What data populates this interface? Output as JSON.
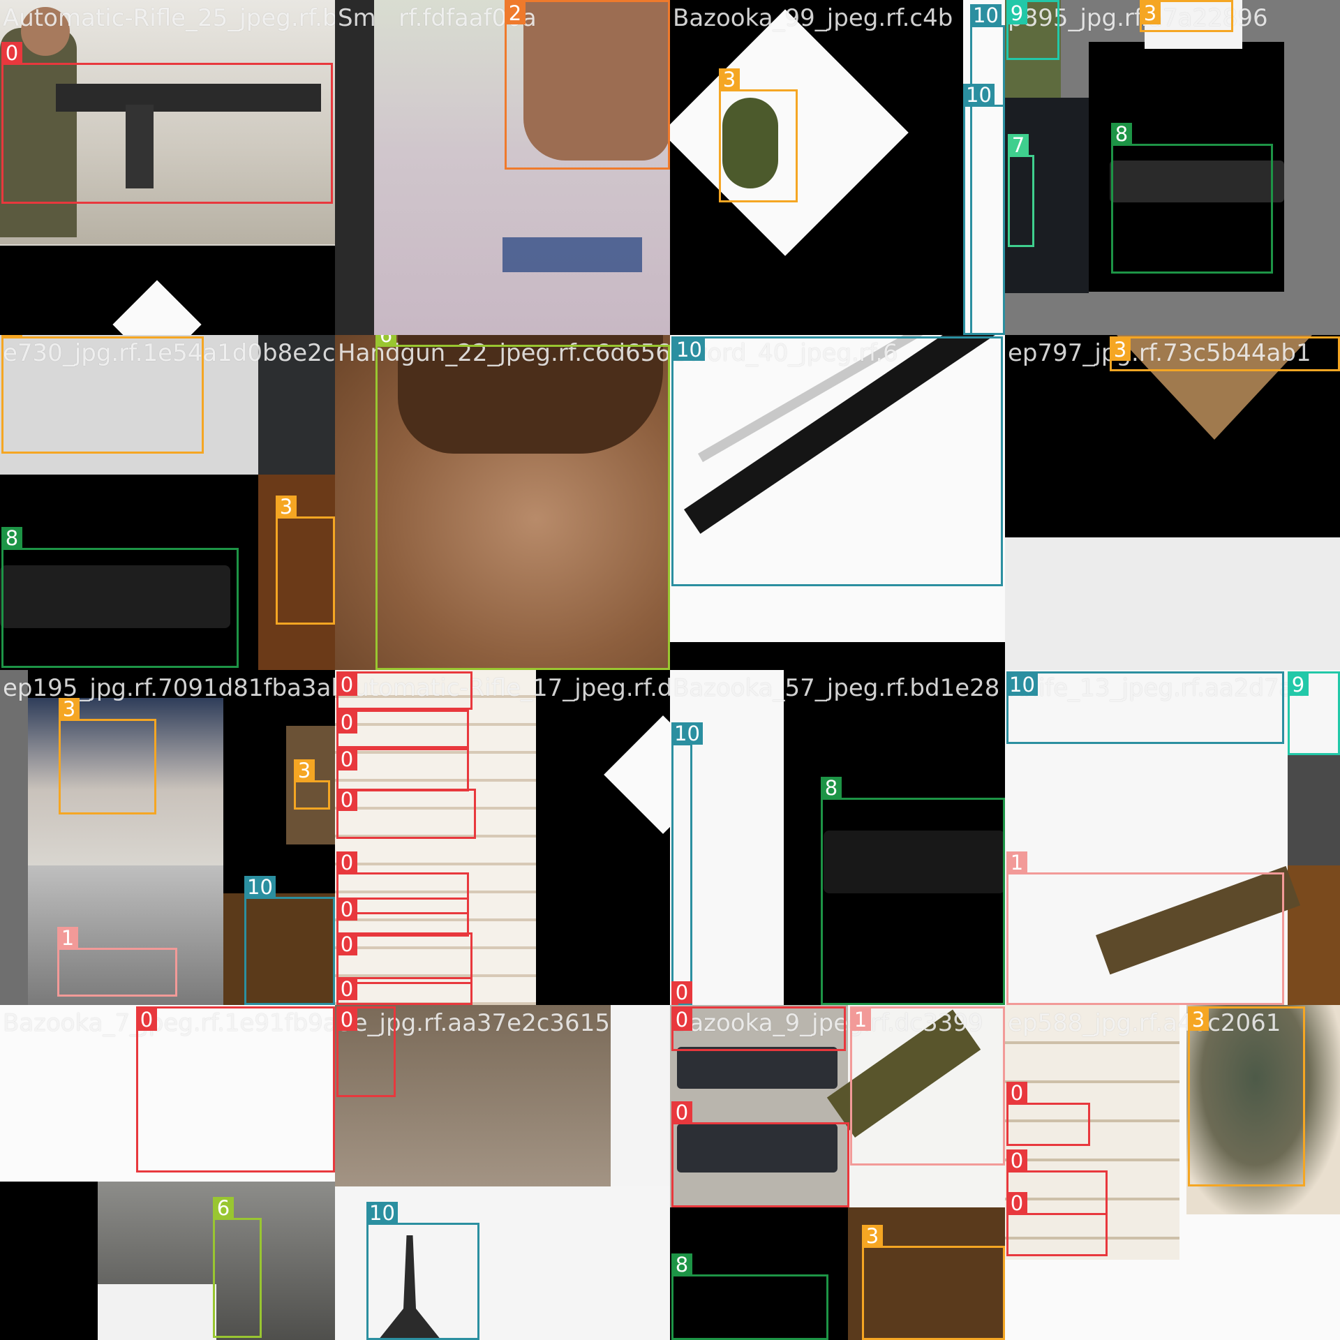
{
  "palette": {
    "0": "#e8383d",
    "1": "#f29a98",
    "2": "#ef7a2c",
    "3": "#f5a623",
    "6": "#99c631",
    "7": "#3fcf8e",
    "8": "#1d9446",
    "9": "#22c8a8",
    "10": "#2b8fa0"
  },
  "tiles": [
    {
      "name": "Automatic-Rifle_25_jpeg.rf.b",
      "class_ids": [
        "0"
      ]
    },
    {
      "name": "Sm   rf.fdfaaf00a",
      "class_ids": [
        "2"
      ]
    },
    {
      "name": "Bazooka_99_jpeg.rf.c4b",
      "class_ids": [
        "3",
        "10",
        "10"
      ]
    },
    {
      "name": "p895_jpg.rf.a7a22896",
      "class_ids": [
        "9",
        "3",
        "7",
        "8"
      ]
    },
    {
      "name": "e730_jpg.rf.1e54a1d0b8e2c5",
      "class_ids": [
        "3",
        "8",
        "3"
      ]
    },
    {
      "name": "Handgun_22_jpeg.rf.c6d656",
      "class_ids": [
        "6"
      ]
    },
    {
      "name": "Sword_40_jpeg.rf.6",
      "class_ids": [
        "10"
      ]
    },
    {
      "name": "ep797_jpg.rf.73c5b44ab1",
      "class_ids": [
        "3"
      ]
    },
    {
      "name": "ep195_jpg.rf.7091d81fba3ab",
      "class_ids": [
        "3",
        "3",
        "1",
        "10"
      ]
    },
    {
      "name": "Automatic-Rifle_17_jpeg.rf.d",
      "class_ids": [
        "0",
        "0",
        "0",
        "0",
        "0",
        "0",
        "0",
        "0"
      ]
    },
    {
      "name": "Bazooka_57_jpeg.rf.bd1e28",
      "class_ids": [
        "10",
        "8",
        "0"
      ]
    },
    {
      "name": "Knife_13_jpeg.rf.aa2d7ab",
      "class_ids": [
        "10",
        "9",
        "1"
      ]
    },
    {
      "name": "Bazooka_7_jpeg.rf.1e91fb9a",
      "class_ids": [
        "0",
        "6"
      ]
    },
    {
      "name": "3e_jpg.rf.aa37e2c3615",
      "class_ids": [
        "0",
        "10"
      ]
    },
    {
      "name": "Bazooka_9_jpeg.rf.dc3399",
      "class_ids": [
        "0",
        "0",
        "1",
        "8",
        "3"
      ]
    },
    {
      "name": "ep588_jpg.rf.a40c2061",
      "class_ids": [
        "0",
        "0",
        "0",
        "3"
      ]
    }
  ]
}
